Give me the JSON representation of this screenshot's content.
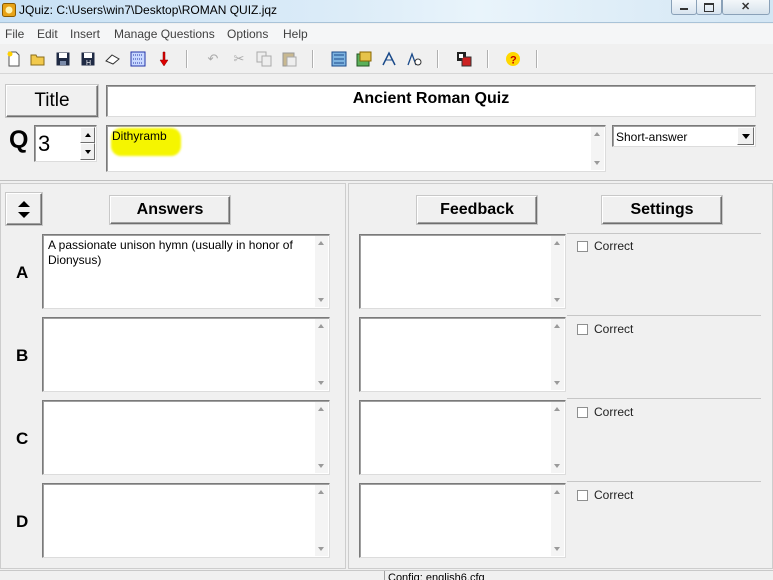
{
  "window": {
    "title": "JQuiz: C:\\Users\\win7\\Desktop\\ROMAN QUIZ.jqz"
  },
  "menu": {
    "items": [
      "File",
      "Edit",
      "Insert",
      "Manage Questions",
      "Options",
      "Help"
    ]
  },
  "title_section": {
    "button_label": "Title",
    "value": "Ancient Roman Quiz"
  },
  "question": {
    "prefix": "Q",
    "number": "3",
    "text": "Dithyramb",
    "type_selected": "Short-answer"
  },
  "headers": {
    "answers": "Answers",
    "feedback": "Feedback",
    "settings": "Settings"
  },
  "rows": [
    {
      "label": "A",
      "answer": "A passionate unison hymn (usually in honor of Dionysus)",
      "feedback": "",
      "correct_label": "Correct"
    },
    {
      "label": "B",
      "answer": "",
      "feedback": "",
      "correct_label": "Correct"
    },
    {
      "label": "C",
      "answer": "",
      "feedback": "",
      "correct_label": "Correct"
    },
    {
      "label": "D",
      "answer": "",
      "feedback": "",
      "correct_label": "Correct"
    }
  ],
  "status_bar": {
    "text": "Config: english6.cfg"
  },
  "colors": {
    "highlight": "#f5f500",
    "titlebar": "#c7e0f4"
  }
}
